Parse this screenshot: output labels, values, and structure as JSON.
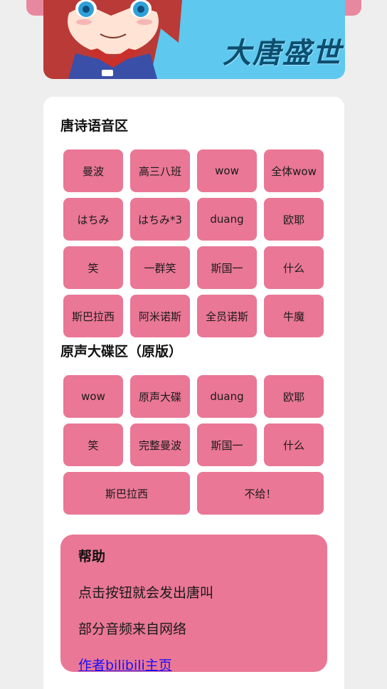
{
  "banner": {
    "title": "大唐盛世",
    "illustration_icon": "anime-girl-illustration"
  },
  "sections": [
    {
      "title": "唐诗语音区",
      "buttons": [
        "曼波",
        "高三八班",
        "wow",
        "全体wow",
        "はちみ",
        "はちみ*3",
        "duang",
        "欧耶",
        "笑",
        "一群笑",
        "斯国一",
        "什么",
        "斯巴拉西",
        "阿米诺斯",
        "全员诺斯",
        "牛魔"
      ]
    },
    {
      "title": "原声大碟区（原版）",
      "buttons": [
        "wow",
        "原声大碟",
        "duang",
        "欧耶",
        "笑",
        "完整曼波",
        "斯国一",
        "什么",
        "斯巴拉西",
        "不给！"
      ]
    }
  ],
  "help": {
    "title": "帮助",
    "line1": "点击按钮就会发出唐叫",
    "line2": "部分音频来自网络",
    "link": "作者bilibili主页"
  },
  "colors": {
    "background": "#eeeeee",
    "card": "#ffffff",
    "button_pink": "#e97795",
    "banner_blue": "#5fc8ee",
    "link_blue": "#1a0dff"
  }
}
